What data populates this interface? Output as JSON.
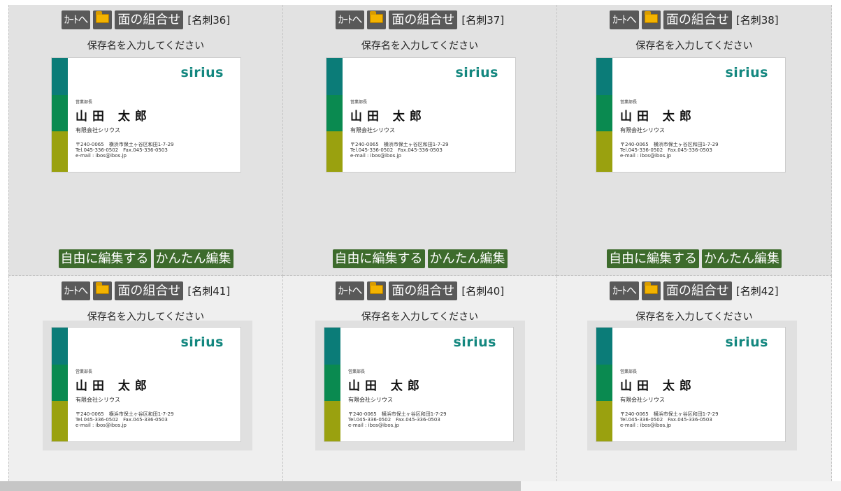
{
  "labels": {
    "cart": "ｶｰﾄへ",
    "combo": "面の組合せ",
    "save_placeholder": "保存名を入力してください",
    "free_edit": "自由に編集する",
    "easy_edit": "かんたん編集"
  },
  "card": {
    "logo": "sirius",
    "title": "営業部長",
    "name": "山田 太郎",
    "company": "有限会社シリウス",
    "address": "〒240-0065　横浜市保土ヶ谷区和田1-7-29",
    "tel_fax": "Tel.045-336-0502　Fax.045-336-0503",
    "email": "e-mail : ibos@ibos.jp",
    "colors": {
      "bar_top": "#0b7c78",
      "bar_mid": "#0a8a50",
      "bar_bottom": "#9aa10f",
      "logo": "#13877f"
    }
  },
  "items": [
    {
      "number": "[名刺36]"
    },
    {
      "number": "[名刺37]"
    },
    {
      "number": "[名刺38]"
    },
    {
      "number": "[名刺41]"
    },
    {
      "number": "[名刺40]"
    },
    {
      "number": "[名刺42]"
    }
  ],
  "icons": {
    "folder": "folder-icon"
  },
  "colors": {
    "toolbar_button": "#595959",
    "edit_button": "#3d6b2c",
    "row1_bg": "#e2e2e2",
    "row2_bg": "#efefef"
  }
}
